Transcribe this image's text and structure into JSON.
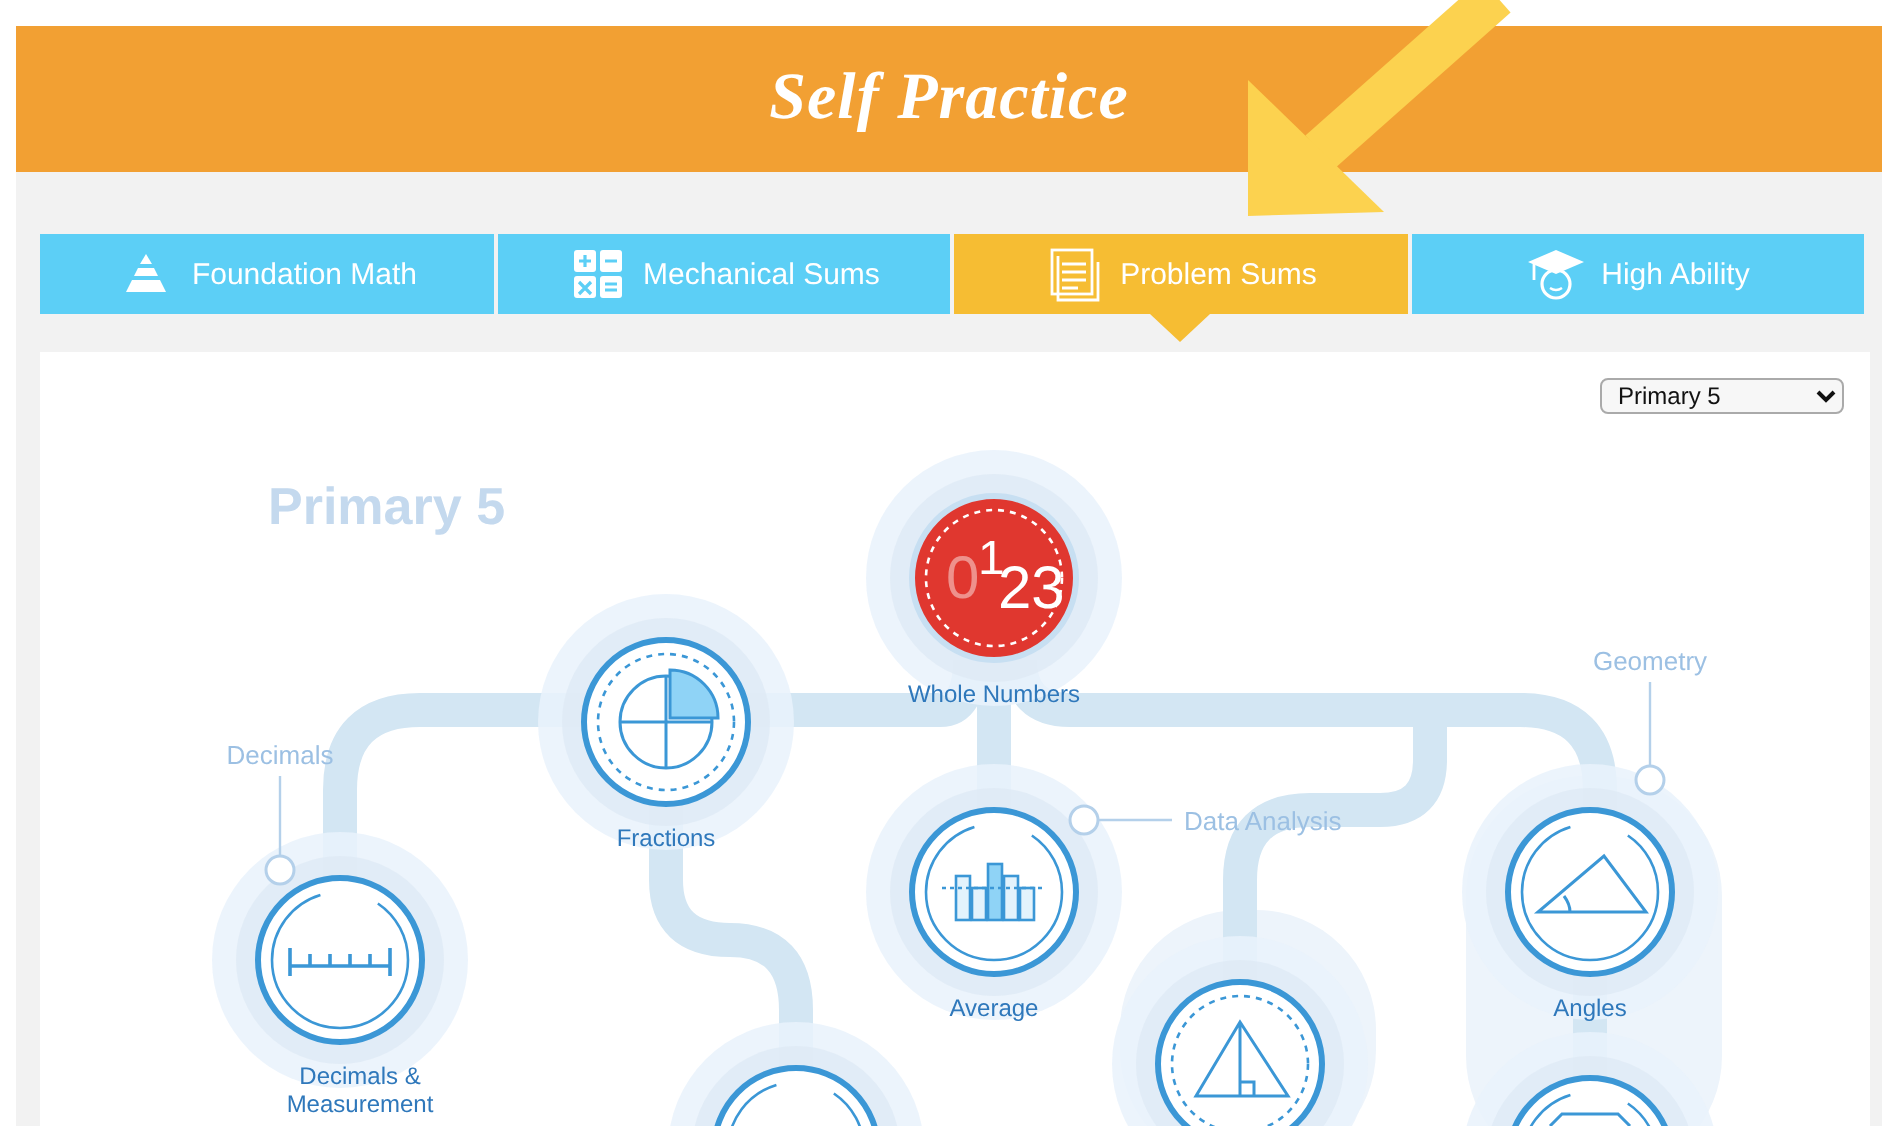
{
  "header": {
    "title": "Self Practice"
  },
  "tabs": [
    {
      "label": "Foundation Math",
      "kind": "pyramid",
      "selected": false
    },
    {
      "label": "Mechanical Sums",
      "kind": "operations",
      "selected": false
    },
    {
      "label": "Problem Sums",
      "kind": "document",
      "selected": true
    },
    {
      "label": "High Ability",
      "kind": "graduate",
      "selected": false
    }
  ],
  "grade_select": {
    "value": "Primary 5"
  },
  "map": {
    "heading": "Primary 5",
    "categories": [
      {
        "label": "Decimals"
      },
      {
        "label": "Geometry"
      },
      {
        "label": "Data Analysis"
      }
    ],
    "nodes": [
      {
        "kind": "numbers",
        "label_lines": [
          "Whole Numbers"
        ],
        "active": true,
        "digits": [
          "0",
          "1",
          "23"
        ]
      },
      {
        "kind": "fractions",
        "label_lines": [
          "Fractions"
        ],
        "active": false
      },
      {
        "kind": "average",
        "label_lines": [
          "Average"
        ],
        "active": false
      },
      {
        "kind": "ruler",
        "label_lines": [
          "Decimals &",
          "Measurement"
        ],
        "active": false
      },
      {
        "kind": "angles",
        "label_lines": [
          "Angles"
        ],
        "active": false
      },
      {
        "kind": "blank",
        "active": false
      },
      {
        "kind": "triangle",
        "active": false
      },
      {
        "kind": "hexagon",
        "active": false
      }
    ]
  }
}
